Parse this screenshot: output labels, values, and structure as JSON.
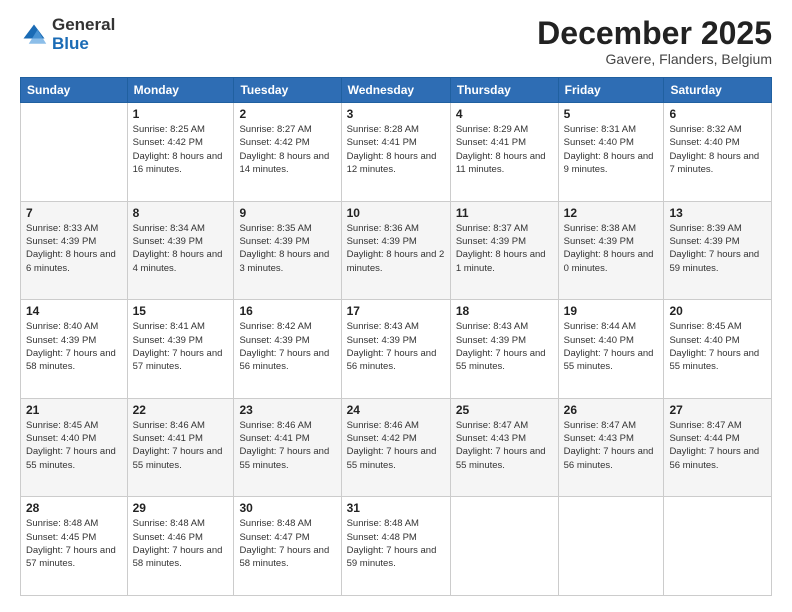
{
  "header": {
    "logo": {
      "line1": "General",
      "line2": "Blue"
    },
    "title": "December 2025",
    "subtitle": "Gavere, Flanders, Belgium"
  },
  "weekdays": [
    "Sunday",
    "Monday",
    "Tuesday",
    "Wednesday",
    "Thursday",
    "Friday",
    "Saturday"
  ],
  "weeks": [
    [
      {
        "day": "",
        "sunrise": "",
        "sunset": "",
        "daylight": ""
      },
      {
        "day": "1",
        "sunrise": "8:25 AM",
        "sunset": "4:42 PM",
        "daylight": "8 hours and 16 minutes."
      },
      {
        "day": "2",
        "sunrise": "8:27 AM",
        "sunset": "4:42 PM",
        "daylight": "8 hours and 14 minutes."
      },
      {
        "day": "3",
        "sunrise": "8:28 AM",
        "sunset": "4:41 PM",
        "daylight": "8 hours and 12 minutes."
      },
      {
        "day": "4",
        "sunrise": "8:29 AM",
        "sunset": "4:41 PM",
        "daylight": "8 hours and 11 minutes."
      },
      {
        "day": "5",
        "sunrise": "8:31 AM",
        "sunset": "4:40 PM",
        "daylight": "8 hours and 9 minutes."
      },
      {
        "day": "6",
        "sunrise": "8:32 AM",
        "sunset": "4:40 PM",
        "daylight": "8 hours and 7 minutes."
      }
    ],
    [
      {
        "day": "7",
        "sunrise": "8:33 AM",
        "sunset": "4:39 PM",
        "daylight": "8 hours and 6 minutes."
      },
      {
        "day": "8",
        "sunrise": "8:34 AM",
        "sunset": "4:39 PM",
        "daylight": "8 hours and 4 minutes."
      },
      {
        "day": "9",
        "sunrise": "8:35 AM",
        "sunset": "4:39 PM",
        "daylight": "8 hours and 3 minutes."
      },
      {
        "day": "10",
        "sunrise": "8:36 AM",
        "sunset": "4:39 PM",
        "daylight": "8 hours and 2 minutes."
      },
      {
        "day": "11",
        "sunrise": "8:37 AM",
        "sunset": "4:39 PM",
        "daylight": "8 hours and 1 minute."
      },
      {
        "day": "12",
        "sunrise": "8:38 AM",
        "sunset": "4:39 PM",
        "daylight": "8 hours and 0 minutes."
      },
      {
        "day": "13",
        "sunrise": "8:39 AM",
        "sunset": "4:39 PM",
        "daylight": "7 hours and 59 minutes."
      }
    ],
    [
      {
        "day": "14",
        "sunrise": "8:40 AM",
        "sunset": "4:39 PM",
        "daylight": "7 hours and 58 minutes."
      },
      {
        "day": "15",
        "sunrise": "8:41 AM",
        "sunset": "4:39 PM",
        "daylight": "7 hours and 57 minutes."
      },
      {
        "day": "16",
        "sunrise": "8:42 AM",
        "sunset": "4:39 PM",
        "daylight": "7 hours and 56 minutes."
      },
      {
        "day": "17",
        "sunrise": "8:43 AM",
        "sunset": "4:39 PM",
        "daylight": "7 hours and 56 minutes."
      },
      {
        "day": "18",
        "sunrise": "8:43 AM",
        "sunset": "4:39 PM",
        "daylight": "7 hours and 55 minutes."
      },
      {
        "day": "19",
        "sunrise": "8:44 AM",
        "sunset": "4:40 PM",
        "daylight": "7 hours and 55 minutes."
      },
      {
        "day": "20",
        "sunrise": "8:45 AM",
        "sunset": "4:40 PM",
        "daylight": "7 hours and 55 minutes."
      }
    ],
    [
      {
        "day": "21",
        "sunrise": "8:45 AM",
        "sunset": "4:40 PM",
        "daylight": "7 hours and 55 minutes."
      },
      {
        "day": "22",
        "sunrise": "8:46 AM",
        "sunset": "4:41 PM",
        "daylight": "7 hours and 55 minutes."
      },
      {
        "day": "23",
        "sunrise": "8:46 AM",
        "sunset": "4:41 PM",
        "daylight": "7 hours and 55 minutes."
      },
      {
        "day": "24",
        "sunrise": "8:46 AM",
        "sunset": "4:42 PM",
        "daylight": "7 hours and 55 minutes."
      },
      {
        "day": "25",
        "sunrise": "8:47 AM",
        "sunset": "4:43 PM",
        "daylight": "7 hours and 55 minutes."
      },
      {
        "day": "26",
        "sunrise": "8:47 AM",
        "sunset": "4:43 PM",
        "daylight": "7 hours and 56 minutes."
      },
      {
        "day": "27",
        "sunrise": "8:47 AM",
        "sunset": "4:44 PM",
        "daylight": "7 hours and 56 minutes."
      }
    ],
    [
      {
        "day": "28",
        "sunrise": "8:48 AM",
        "sunset": "4:45 PM",
        "daylight": "7 hours and 57 minutes."
      },
      {
        "day": "29",
        "sunrise": "8:48 AM",
        "sunset": "4:46 PM",
        "daylight": "7 hours and 58 minutes."
      },
      {
        "day": "30",
        "sunrise": "8:48 AM",
        "sunset": "4:47 PM",
        "daylight": "7 hours and 58 minutes."
      },
      {
        "day": "31",
        "sunrise": "8:48 AM",
        "sunset": "4:48 PM",
        "daylight": "7 hours and 59 minutes."
      },
      {
        "day": "",
        "sunrise": "",
        "sunset": "",
        "daylight": ""
      },
      {
        "day": "",
        "sunrise": "",
        "sunset": "",
        "daylight": ""
      },
      {
        "day": "",
        "sunrise": "",
        "sunset": "",
        "daylight": ""
      }
    ]
  ]
}
